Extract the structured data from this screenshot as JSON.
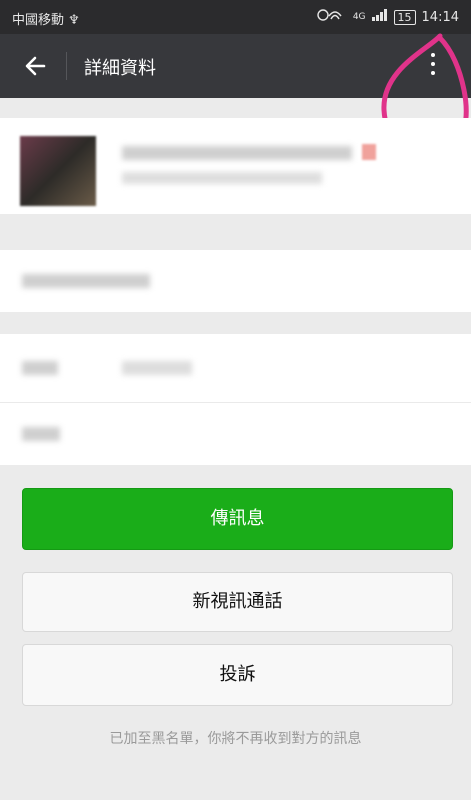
{
  "status_bar": {
    "carrier": "中國移動 ♆",
    "network": "4G",
    "battery": "15",
    "time": "14:14"
  },
  "header": {
    "title": "詳細資料"
  },
  "actions": {
    "send_message": "傳訊息",
    "video_call": "新視訊通話",
    "report": "投訴"
  },
  "note": "已加至黑名單，你將不再收到對方的訊息",
  "colors": {
    "accent": "#1aad19",
    "header_bg": "#37383c",
    "annotation": "#e0338a"
  }
}
